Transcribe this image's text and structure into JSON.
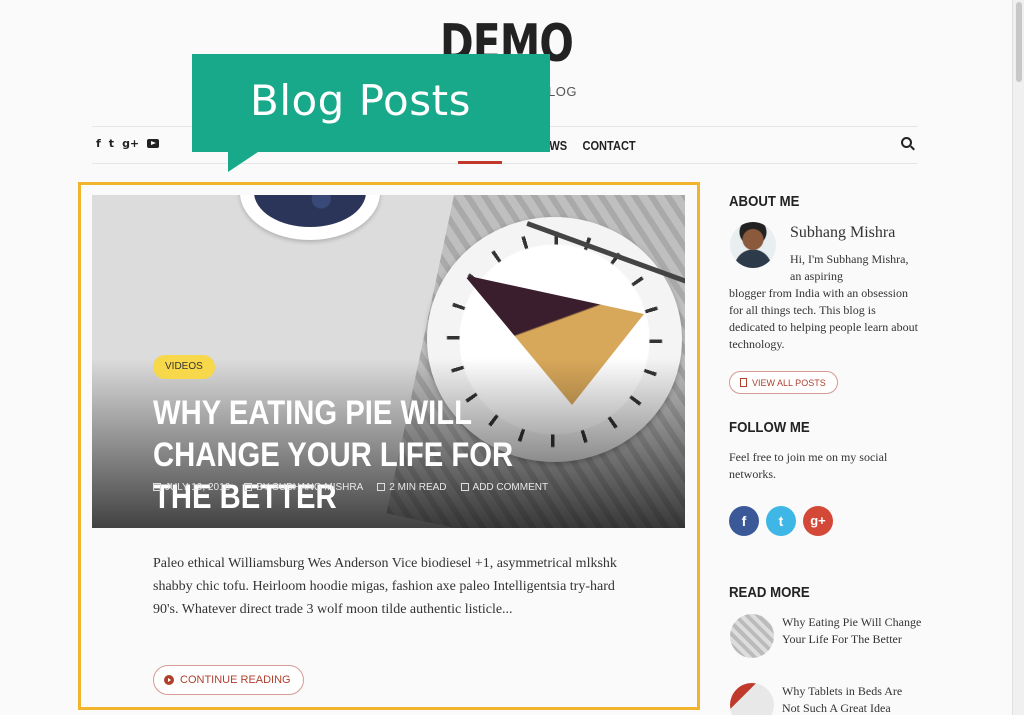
{
  "site": {
    "logo": "DEMO",
    "tagline_fragment": "LOG"
  },
  "nav": {
    "social_icons": [
      "facebook-icon",
      "twitter-icon",
      "google-plus-icon",
      "youtube-icon"
    ],
    "social_labels": {
      "facebook": "f",
      "twitter": "t",
      "google_plus": "g+"
    },
    "visible_items": [
      "EWS",
      "CONTACT"
    ]
  },
  "callout": {
    "label": "Blog Posts"
  },
  "post": {
    "category": "VIDEOS",
    "title": "WHY EATING PIE WILL CHANGE YOUR LIFE FOR THE BETTER",
    "date": "JULY 19, 2016",
    "author": "BY SUBHANG MISHRA",
    "read_time": "2 MIN READ",
    "comment": "ADD COMMENT",
    "excerpt": "Paleo ethical Williamsburg Wes Anderson Vice biodiesel +1, asymmetrical mlkshk shabby chic tofu. Heirloom hoodie migas, fashion axe paleo Intelligentsia try-hard 90's. Whatever direct trade 3 wolf moon tilde authentic listicle...",
    "continue_label": "CONTINUE READING"
  },
  "sidebar": {
    "about_heading": "ABOUT ME",
    "author_name": "Subhang Mishra",
    "about_text_1": "Hi, I'm Subhang Mishra, an aspiring",
    "about_text_2": "blogger from India with an obsession for all things tech. This blog is dedicated to helping people learn about technology.",
    "view_all_label": "VIEW ALL POSTS",
    "follow_heading": "FOLLOW ME",
    "follow_text": "Feel free to join me on my social networks.",
    "follow_icons": [
      {
        "name": "facebook-icon",
        "glyph": "f",
        "color": "#3b5998"
      },
      {
        "name": "twitter-icon",
        "glyph": "t",
        "color": "#3fb7e6"
      },
      {
        "name": "google-plus-icon",
        "glyph": "g+",
        "color": "#d34836"
      }
    ],
    "read_more_heading": "READ MORE",
    "read_more": [
      {
        "title": "Why Eating Pie Will Change Your Life For The Better"
      },
      {
        "title": "Why Tablets in Beds Are Not Such A Great Idea"
      }
    ]
  },
  "colors": {
    "accent": "#c0392b",
    "callout": "#18a88a",
    "frame": "#f2b42c",
    "badge": "#f6d84a"
  }
}
